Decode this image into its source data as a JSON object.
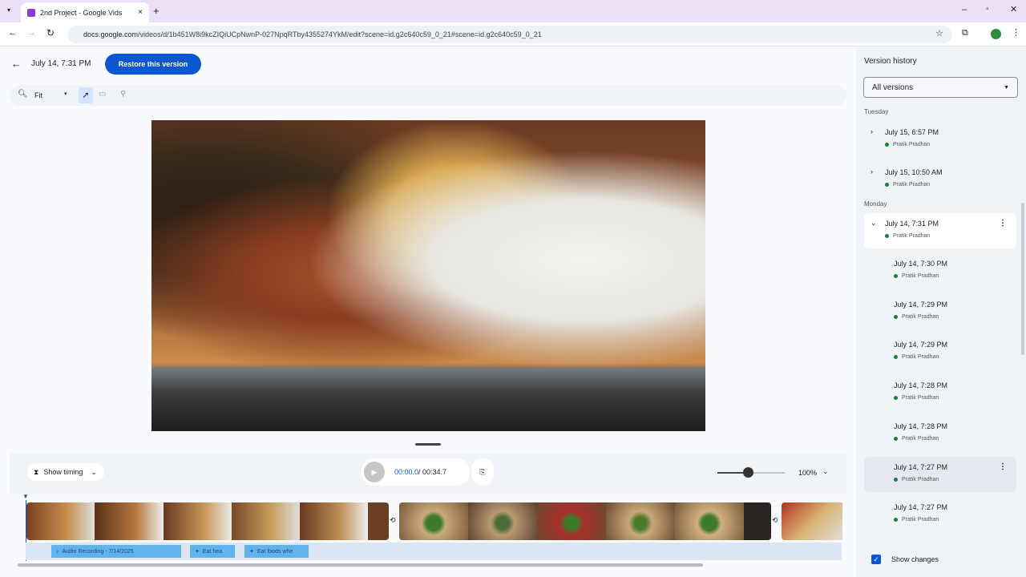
{
  "browser": {
    "tab_title": "2nd Project - Google Vids",
    "url_host": "docs.google.com",
    "url_path": "/videos/d/1b451W8i9kcZIQiUCpNwnP-027NpqRTby4355274YkM/edit?scene=id.g2c640c59_0_21#scene=id.g2c640c59_0_21"
  },
  "header": {
    "version_title": "July 14, 7:31 PM",
    "restore_label": "Restore this version"
  },
  "toolbar": {
    "zoom_label": "Fit"
  },
  "timeline": {
    "show_timing": "Show timing",
    "current_time": "00:00.0",
    "total_time": " / 00:34.7",
    "zoom_percent": "100%",
    "zoom_slider_fraction": 0.45,
    "chips": [
      "Audio Recording - 7/14/2025",
      "Eat hea",
      "Eat foods whe"
    ]
  },
  "panel": {
    "title": "Version history",
    "filter": "All versions",
    "groups": [
      {
        "day": "Tuesday",
        "versions": [
          {
            "time": "July 15, 6:57 PM",
            "author": "Pratik Pradhan"
          },
          {
            "time": "July 15, 10:50 AM",
            "author": "Pratik Pradhan"
          }
        ]
      },
      {
        "day": "Monday",
        "versions": [
          {
            "time": "July 14, 7:31 PM",
            "author": "Pratik Pradhan"
          }
        ],
        "sub": [
          {
            "time": "July 14, 7:30 PM",
            "author": "Pratik Pradhan"
          },
          {
            "time": "July 14, 7:29 PM",
            "author": "Pratik Pradhan"
          },
          {
            "time": "July 14, 7:29 PM",
            "author": "Pratik Pradhan"
          },
          {
            "time": "July 14, 7:28 PM",
            "author": "Pratik Pradhan"
          },
          {
            "time": "July 14, 7:28 PM",
            "author": "Pratik Pradhan"
          },
          {
            "time": "July 14, 7:27 PM",
            "author": "Pratik Pradhan"
          },
          {
            "time": "July 14, 7:27 PM",
            "author": "Pratik Pradhan"
          }
        ]
      }
    ],
    "show_changes": "Show changes"
  },
  "colors": {
    "accent": "#0b57d0",
    "author_dot": "#188038"
  }
}
